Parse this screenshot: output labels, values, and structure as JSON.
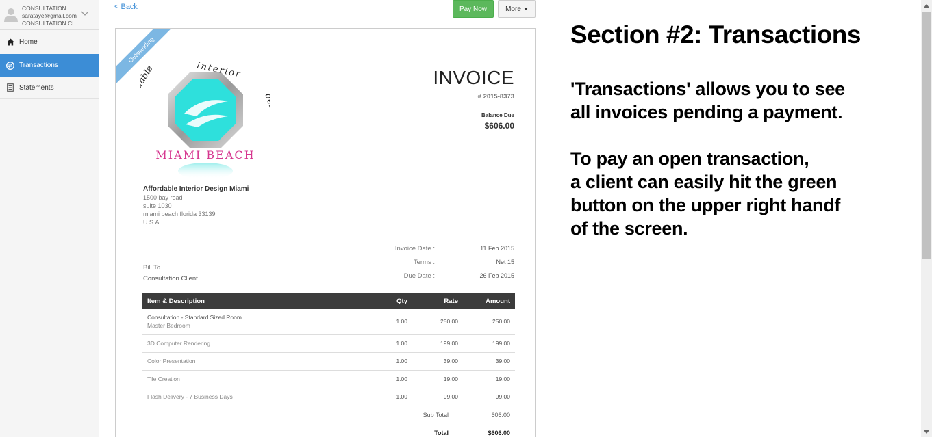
{
  "sidebar": {
    "user": {
      "line1": "CONSULTATION",
      "line2": "sarataye@gmail.com",
      "line3": "CONSULTATION CL..."
    },
    "items": [
      {
        "label": "Home",
        "icon": "home-icon"
      },
      {
        "label": "Transactions",
        "icon": "transactions-icon"
      },
      {
        "label": "Statements",
        "icon": "statements-icon"
      }
    ],
    "active_index": 1
  },
  "toolbar": {
    "back_label": "< Back",
    "pay_now_label": "Pay Now",
    "more_label": "More"
  },
  "invoice": {
    "ribbon": "Outstanding",
    "logo_text": {
      "top": "affordable interior design",
      "city": "MIAMI BEACH"
    },
    "title": "INVOICE",
    "number": "# 2015-8373",
    "balance_label": "Balance Due",
    "balance_value": "$606.00",
    "company": {
      "name": "Affordable Interior Design Miami",
      "address": [
        "1500 bay road",
        "suite 1030",
        "miami beach florida 33139",
        "U.S.A"
      ]
    },
    "meta": [
      {
        "label": "Invoice Date :",
        "value": "11 Feb 2015"
      },
      {
        "label": "Terms :",
        "value": "Net 15"
      },
      {
        "label": "Due Date :",
        "value": "26 Feb 2015"
      }
    ],
    "bill_to_label": "Bill To",
    "bill_to_value": "Consultation Client",
    "table": {
      "headers": {
        "item": "Item & Description",
        "qty": "Qty",
        "rate": "Rate",
        "amount": "Amount"
      },
      "rows": [
        {
          "item": "Consultation - Standard Sized Room",
          "desc": "Master Bedroom",
          "qty": "1.00",
          "rate": "250.00",
          "amount": "250.00"
        },
        {
          "item": "3D Computer Rendering",
          "desc": "",
          "qty": "1.00",
          "rate": "199.00",
          "amount": "199.00"
        },
        {
          "item": "Color Presentation",
          "desc": "",
          "qty": "1.00",
          "rate": "39.00",
          "amount": "39.00"
        },
        {
          "item": "Tile Creation",
          "desc": "",
          "qty": "1.00",
          "rate": "19.00",
          "amount": "19.00"
        },
        {
          "item": "Flash Delivery - 7 Business Days",
          "desc": "",
          "qty": "1.00",
          "rate": "99.00",
          "amount": "99.00"
        }
      ]
    },
    "subtotal_label": "Sub Total",
    "subtotal_value": "606.00",
    "total_label": "Total",
    "total_value": "$606.00"
  },
  "explanation": {
    "title": "Section #2:  Transactions",
    "para1": [
      "'Transactions' allows you to see",
      "all invoices pending a payment."
    ],
    "para2": [
      "To pay an open transaction,",
      "a client can easily hit the green",
      "button on the upper right handf",
      "of the screen."
    ]
  },
  "colors": {
    "accent": "#3c8dd6",
    "pay_button": "#5cb85c",
    "table_header": "#3c3c3c",
    "logo_teal": "#2ee0dc",
    "logo_pink": "#d6368f"
  }
}
